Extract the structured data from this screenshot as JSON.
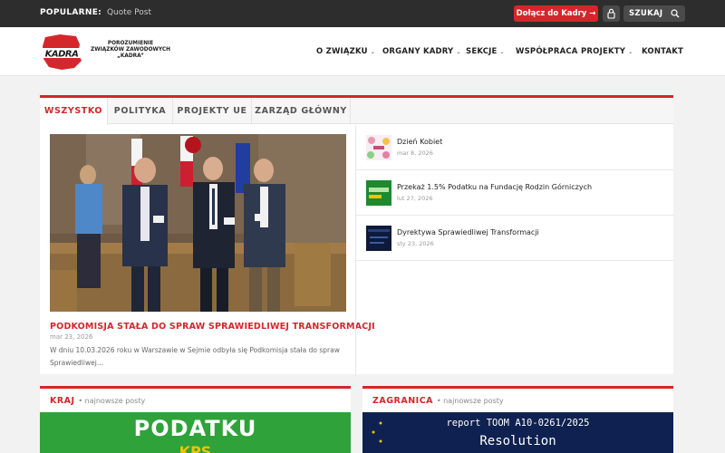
{
  "topbar": {
    "popular_label": "POPULARNE:",
    "popular_link": "Quote Post",
    "join_button": "Dołącz do Kadry →",
    "search_label": "SZUKAJ"
  },
  "header": {
    "logo_text": "KADRA",
    "org_name": [
      "POROZUMIENIE",
      "ZWIĄZKÓW ZAWODOWYCH",
      "„KADRA”"
    ],
    "nav": [
      {
        "label": "O ZWIĄZKU",
        "has_dropdown": true
      },
      {
        "label": "ORGANY KADRY",
        "has_dropdown": true
      },
      {
        "label": "SEKCJE",
        "has_dropdown": true
      },
      {
        "label": "WSPÓŁPRACA",
        "has_dropdown": false
      },
      {
        "label": "PROJEKTY",
        "has_dropdown": true
      },
      {
        "label": "KONTAKT",
        "has_dropdown": false
      }
    ]
  },
  "tabs": [
    "WSZYSTKO",
    "POLITYKA",
    "PROJEKTY UE",
    "ZARZĄD GŁÓWNY"
  ],
  "featured": {
    "title": "PODKOMISJA STAŁA DO SPRAW SPRAWIEDLIWEJ TRANSFORMACJI",
    "date": "mar 23, 2026",
    "excerpt": "W dniu 10.03.2026 roku w Warszawie w Sejmie odbyła się Podkomisja stała do spraw Sprawiedliwej…"
  },
  "side_posts": [
    {
      "title": "Dzień Kobiet",
      "date": "mar 8, 2026"
    },
    {
      "title": "Przekaż 1.5% Podatku na Fundację Rodzin Górniczych",
      "date": "lut 27, 2026"
    },
    {
      "title": "Dyrektywa Sprawiedliwej Transformacji",
      "date": "sty 23, 2026"
    }
  ],
  "sections": [
    {
      "title": "KRAJ",
      "subtitle": "• najnowsze posty",
      "image_text": [
        "PODATKU",
        "KPS"
      ]
    },
    {
      "title": "ZAGRANICA",
      "subtitle": "• najnowsze posty",
      "image_text": [
        "report TOOM A10-0261/2025",
        "Resolution"
      ]
    }
  ],
  "colors": {
    "accent": "#d3272b",
    "topbar": "#2d2d2d",
    "page_bg": "#f2f2f2"
  }
}
